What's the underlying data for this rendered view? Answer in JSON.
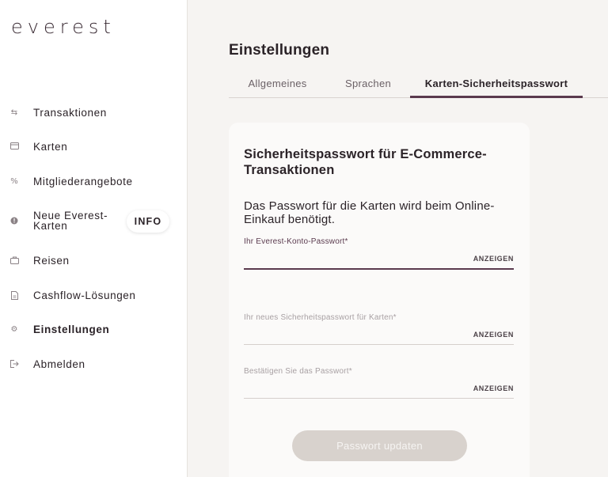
{
  "brand": {
    "logo_text": "everest"
  },
  "sidebar": {
    "items": [
      {
        "label": "Transaktionen",
        "icon": "transfer-arrows-icon"
      },
      {
        "label": "Karten",
        "icon": "card-icon"
      },
      {
        "label": "Mitgliederangebote",
        "icon": "percent-icon"
      },
      {
        "label": "Neue Everest-Karten",
        "icon": "info-dot-icon",
        "badge": "INFO"
      },
      {
        "label": "Reisen",
        "icon": "suitcase-icon"
      },
      {
        "label": "Cashflow-Lösungen",
        "icon": "document-icon"
      },
      {
        "label": "Einstellungen",
        "icon": "gear-icon",
        "active": true
      },
      {
        "label": "Abmelden",
        "icon": "logout-icon"
      }
    ]
  },
  "main": {
    "title": "Einstellungen",
    "tabs": [
      {
        "label": "Allgemeines",
        "active": false
      },
      {
        "label": "Sprachen",
        "active": false
      },
      {
        "label": "Karten-Sicherheitspasswort",
        "active": true
      }
    ],
    "card": {
      "title": "Sicherheitspasswort für E-Commerce-Transaktionen",
      "description": "Das Passwort für die Karten wird beim Online-Einkauf benötigt.",
      "fields": [
        {
          "label": "Ihr Everest-Konto-Passwort",
          "required_mark": "*",
          "show_label": "ANZEIGEN",
          "value": "",
          "focused": true
        },
        {
          "label": "Ihr neues Sicherheitspasswort für Karten",
          "required_mark": "*",
          "show_label": "ANZEIGEN",
          "value": "",
          "focused": false
        },
        {
          "label": "Bestätigen Sie das Passwort",
          "required_mark": "*",
          "show_label": "ANZEIGEN",
          "value": "",
          "focused": false
        }
      ],
      "submit_label": "Passwort updaten"
    }
  },
  "colors": {
    "accent": "#5a3a4e",
    "main_bg": "#f6f4f2",
    "card_bg": "#fbfaf9",
    "button_disabled_bg": "#d8d2cd"
  }
}
